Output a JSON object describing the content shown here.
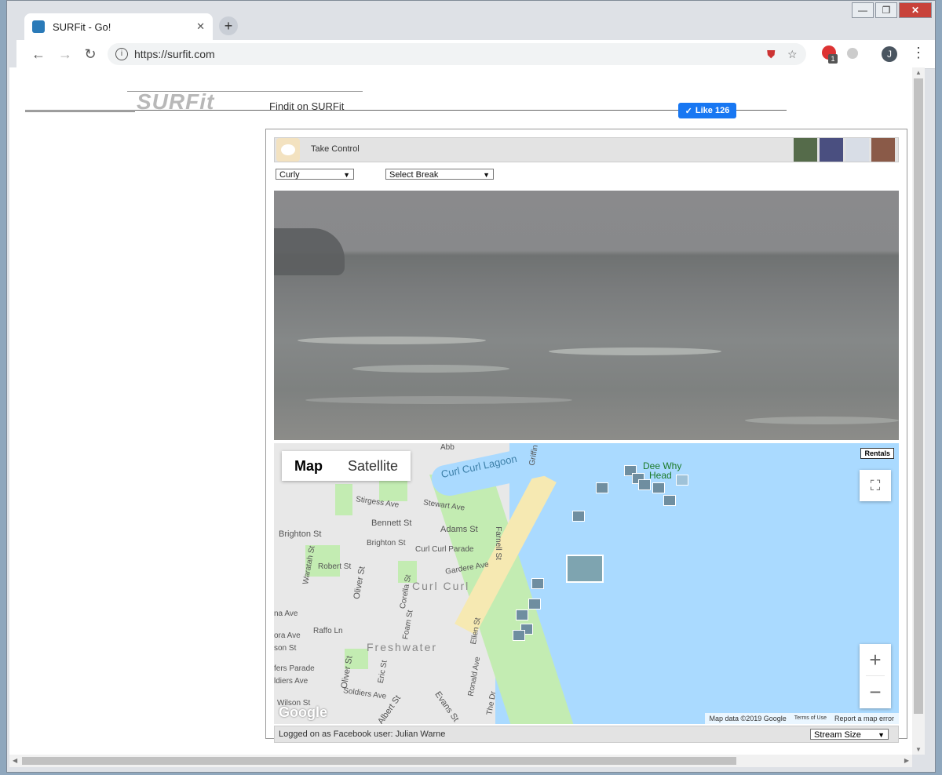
{
  "browser": {
    "tab_title": "SURFit - Go!",
    "new_tab_label": "+",
    "url": "https://surfit.com",
    "profile_initial": "J",
    "ext_badge": "1"
  },
  "site": {
    "logo_text": "SURFit",
    "tagline": "Findit on SURFit",
    "like_label": "Like 126"
  },
  "control": {
    "take_control": "Take Control",
    "location_select": "Curly",
    "break_select": "Select Break"
  },
  "map": {
    "type_map": "Map",
    "type_satellite": "Satellite",
    "rentals": "Rentals",
    "labels": {
      "lagoon": "Curl Curl Lagoon",
      "dee_why": "Dee Why",
      "head": "Head",
      "stirgess": "Stirgess Ave",
      "stewart": "Stewart Ave",
      "bennett": "Bennett St",
      "adams": "Adams St",
      "brighton1": "Brighton St",
      "brighton2": "Brighton St",
      "curl_parade": "Curl Curl Parade",
      "robert": "Robert St",
      "waratah": "Waratah St",
      "oliver1": "Oliver St",
      "oliver2": "Oliver St",
      "gardere": "Gardere Ave",
      "farnell": "Farnell St",
      "griffin": "Griffin",
      "raffo": "Raffo Ln",
      "soldiers": "Soldiers Ave",
      "albert": "Albert St",
      "evans": "Evans St",
      "eric": "Eric St",
      "foam": "Foam St",
      "ellen": "Ellen St",
      "ronald": "Ronald Ave",
      "tedr": "The Dr",
      "wilson": "Wilson St",
      "parade": "fers Parade",
      "ave1": "na Ave",
      "ave2": "ora Ave",
      "ave3": "ldiers Ave",
      "st1": "son St",
      "corella": "Corella St",
      "abbott": "Abb"
    },
    "area_curl": "Curl Curl",
    "area_fresh": "Freshwater",
    "google": "Google",
    "attrib_data": "Map data ©2019 Google",
    "attrib_terms": "Terms of Use",
    "attrib_report": "Report a map error",
    "zoom_in": "+",
    "zoom_out": "−"
  },
  "footer": {
    "logged_in": "Logged on as Facebook user: Julian Warne",
    "stream_size": "Stream Size"
  },
  "colors": {
    "like": "#1877f2",
    "sea": "#aadaff",
    "park": "#c3ecb2"
  }
}
